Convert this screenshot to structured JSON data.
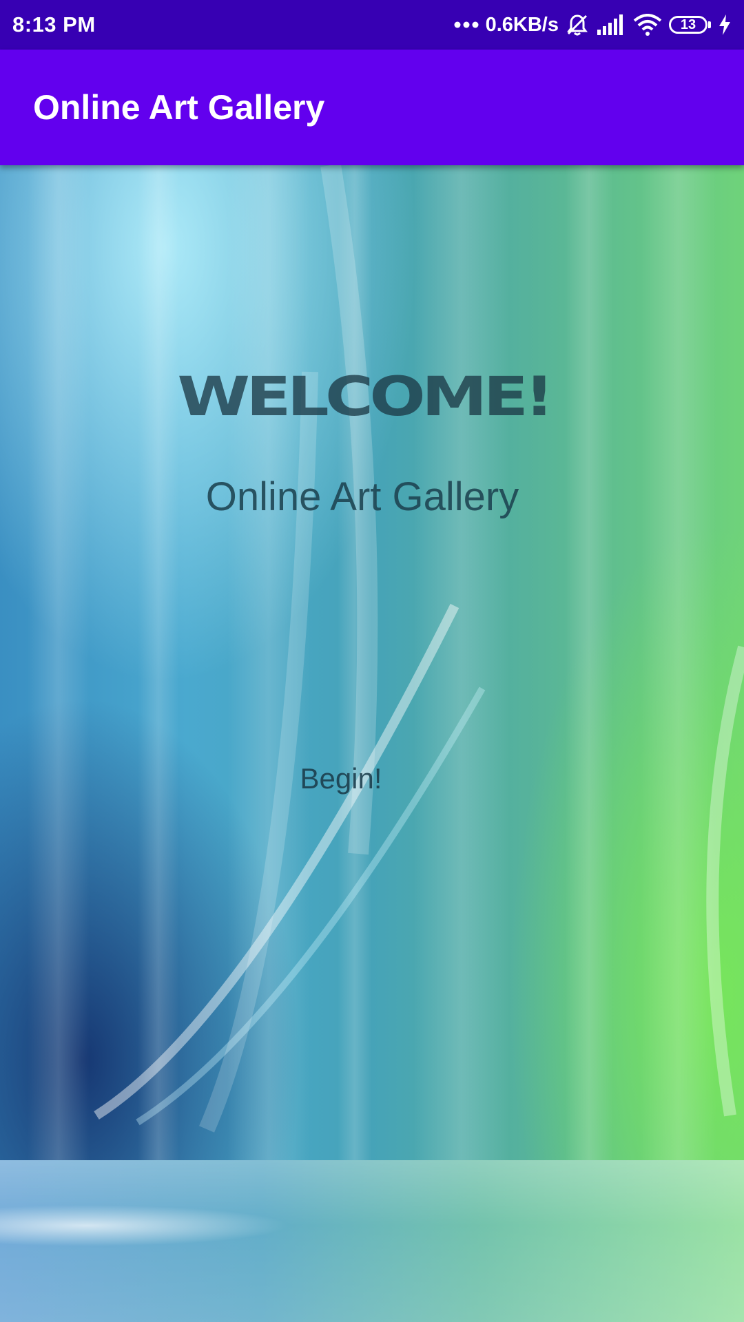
{
  "status_bar": {
    "time": "8:13 PM",
    "network_speed": "0.6KB/s",
    "battery_level": "13",
    "icons": [
      "more-dots-icon",
      "mute-notifications-icon",
      "signal-icon",
      "wifi-icon",
      "battery-icon",
      "charging-bolt-icon"
    ]
  },
  "app_bar": {
    "title": "Online Art Gallery"
  },
  "main": {
    "welcome": "WELCOME!",
    "subtitle": "Online Art Gallery",
    "begin_label": "Begin!"
  },
  "colors": {
    "status_bar": "#3700b3",
    "app_bar": "#6200ee",
    "text_dark": "#1c3a46"
  }
}
